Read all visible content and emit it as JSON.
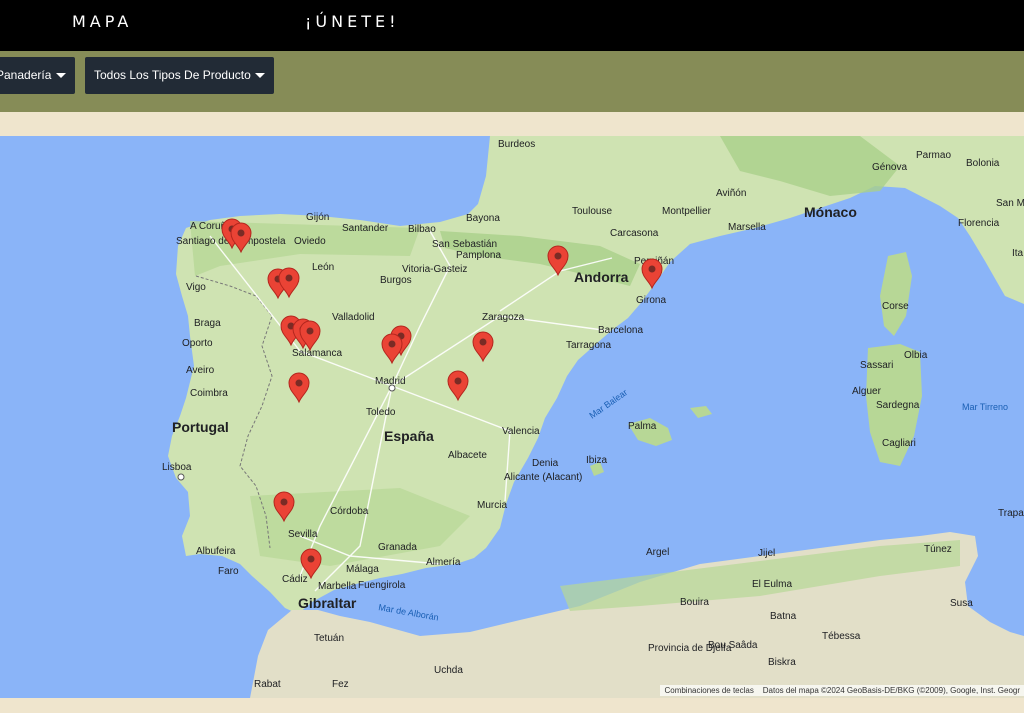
{
  "nav": {
    "items": [
      "MAPA",
      "¡ÚNETE!"
    ]
  },
  "filters": {
    "category": "Panadería",
    "product_type": "Todos Los Tipos De Producto"
  },
  "map": {
    "attribution": {
      "shortcuts": "Combinaciones de teclas",
      "data": "Datos del mapa ©2024 GeoBasis-DE/BKG (©2009), Google, Inst. Geogr"
    },
    "labels": [
      {
        "text": "Portugal",
        "cls": "big"
      },
      {
        "text": "España",
        "cls": "big"
      },
      {
        "text": "Andorra",
        "cls": "big"
      },
      {
        "text": "Mónaco",
        "cls": "big"
      },
      {
        "text": "Gibraltar",
        "cls": "big"
      },
      {
        "text": "Burdeos",
        "cls": "city"
      },
      {
        "text": "Toulouse",
        "cls": "city"
      },
      {
        "text": "Montpellier",
        "cls": "city"
      },
      {
        "text": "Aviñón",
        "cls": "city"
      },
      {
        "text": "Marsella",
        "cls": "city"
      },
      {
        "text": "Carcasona",
        "cls": "city"
      },
      {
        "text": "Perpiñán",
        "cls": "city"
      },
      {
        "text": "Génova",
        "cls": "city"
      },
      {
        "text": "Parmao",
        "cls": "city"
      },
      {
        "text": "Bolonia",
        "cls": "city"
      },
      {
        "text": "Florencia",
        "cls": "city"
      },
      {
        "text": "San Ma",
        "cls": "city"
      },
      {
        "text": "Ita",
        "cls": "city"
      },
      {
        "text": "A Coruña",
        "cls": "city"
      },
      {
        "text": "Santiago de Compostela",
        "cls": "city"
      },
      {
        "text": "Gijón",
        "cls": "city"
      },
      {
        "text": "Oviedo",
        "cls": "city"
      },
      {
        "text": "Santander",
        "cls": "city"
      },
      {
        "text": "Bilbao",
        "cls": "city"
      },
      {
        "text": "Bayona",
        "cls": "city"
      },
      {
        "text": "San Sebastián",
        "cls": "city"
      },
      {
        "text": "Pamplona",
        "cls": "city"
      },
      {
        "text": "Vitoria-Gasteiz",
        "cls": "city"
      },
      {
        "text": "León",
        "cls": "city"
      },
      {
        "text": "Burgos",
        "cls": "city"
      },
      {
        "text": "Vigo",
        "cls": "city"
      },
      {
        "text": "Braga",
        "cls": "city"
      },
      {
        "text": "Oporto",
        "cls": "city"
      },
      {
        "text": "Aveiro",
        "cls": "city"
      },
      {
        "text": "Coimbra",
        "cls": "city"
      },
      {
        "text": "Lisboa",
        "cls": "city"
      },
      {
        "text": "Valladolid",
        "cls": "city"
      },
      {
        "text": "Salamanca",
        "cls": "city"
      },
      {
        "text": "Zaragoza",
        "cls": "city"
      },
      {
        "text": "Barcelona",
        "cls": "city"
      },
      {
        "text": "Tarragona",
        "cls": "city"
      },
      {
        "text": "Girona",
        "cls": "city"
      },
      {
        "text": "Madrid",
        "cls": "city"
      },
      {
        "text": "Toledo",
        "cls": "city"
      },
      {
        "text": "Valencia",
        "cls": "city"
      },
      {
        "text": "Albacete",
        "cls": "city"
      },
      {
        "text": "Alicante (Alacant)",
        "cls": "city"
      },
      {
        "text": "Denia",
        "cls": "city"
      },
      {
        "text": "Ibiza",
        "cls": "city"
      },
      {
        "text": "Palma",
        "cls": "city"
      },
      {
        "text": "Murcia",
        "cls": "city"
      },
      {
        "text": "Córdoba",
        "cls": "city"
      },
      {
        "text": "Granada",
        "cls": "city"
      },
      {
        "text": "Almería",
        "cls": "city"
      },
      {
        "text": "Málaga",
        "cls": "city"
      },
      {
        "text": "Sevilla",
        "cls": "city"
      },
      {
        "text": "Albufeira",
        "cls": "city"
      },
      {
        "text": "Faro",
        "cls": "city"
      },
      {
        "text": "Cádiz",
        "cls": "city"
      },
      {
        "text": "Marbella",
        "cls": "city"
      },
      {
        "text": "Fuengirola",
        "cls": "city"
      },
      {
        "text": "Tetuán",
        "cls": "city"
      },
      {
        "text": "Rabat",
        "cls": "city"
      },
      {
        "text": "Fez",
        "cls": "city"
      },
      {
        "text": "Uchda",
        "cls": "city"
      },
      {
        "text": "Argel",
        "cls": "city"
      },
      {
        "text": "Jijel",
        "cls": "city"
      },
      {
        "text": "El Eulma",
        "cls": "city"
      },
      {
        "text": "Bouira",
        "cls": "city"
      },
      {
        "text": "Batna",
        "cls": "city"
      },
      {
        "text": "Provincia de Djelfa",
        "cls": "city"
      },
      {
        "text": "Bou Saâda",
        "cls": "city"
      },
      {
        "text": "Biskra",
        "cls": "city"
      },
      {
        "text": "Tébessa",
        "cls": "city"
      },
      {
        "text": "Túnez",
        "cls": "city"
      },
      {
        "text": "Susa",
        "cls": "city"
      },
      {
        "text": "Trapa",
        "cls": "city"
      },
      {
        "text": "Corse",
        "cls": "city"
      },
      {
        "text": "Olbia",
        "cls": "city"
      },
      {
        "text": "Sassari",
        "cls": "city"
      },
      {
        "text": "Alguer",
        "cls": "city"
      },
      {
        "text": "Sardegna",
        "cls": "city"
      },
      {
        "text": "Cagliari",
        "cls": "city"
      },
      {
        "text": "Mar Tirreno",
        "cls": "sea"
      },
      {
        "text": "Mar Balear",
        "cls": "sea"
      },
      {
        "text": "Mar de Alborán",
        "cls": "sea"
      }
    ]
  }
}
